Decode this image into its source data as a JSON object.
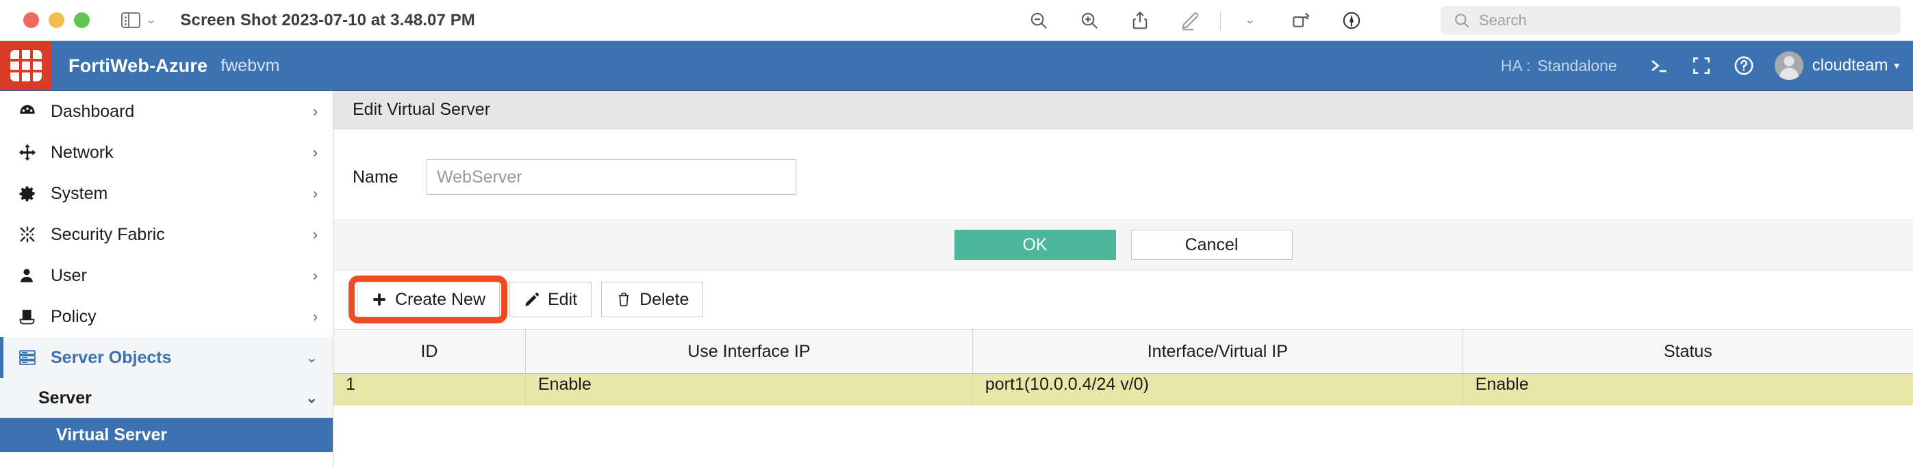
{
  "window": {
    "title": "Screen Shot 2023-07-10 at 3.48.07 PM",
    "traffic_lights": [
      "close",
      "minimize",
      "zoom"
    ],
    "sidebar_toggle_icon": "sidebar-panel-icon",
    "toolbar": [
      {
        "name": "zoom-out",
        "icon": "magnifier-minus-icon"
      },
      {
        "name": "zoom-in",
        "icon": "magnifier-plus-icon"
      },
      {
        "name": "share",
        "icon": "share-upload-icon"
      },
      {
        "name": "markup",
        "icon": "pencil-markup-icon"
      },
      {
        "name": "markup-dropdown",
        "icon": "chevron-down-icon"
      },
      {
        "name": "rotate",
        "icon": "rotate-left-icon"
      },
      {
        "name": "annotate",
        "icon": "annotate-circle-icon"
      }
    ],
    "search": {
      "placeholder": "Search",
      "value": "",
      "icon": "search-icon"
    }
  },
  "appbar": {
    "logo": "fortinet-logo",
    "brand": "FortiWeb-Azure",
    "hostname": "fwebvm",
    "ha_label": "HA :",
    "ha_value": "Standalone",
    "cli_icon": "cli-console-icon",
    "fullscreen_icon": "fullscreen-icon",
    "help_icon": "help-question-icon",
    "avatar": "user-avatar",
    "user": "cloudteam",
    "user_caret": "▾",
    "accent_blue": "#3c72b2",
    "logo_red": "#da3b26"
  },
  "sidebar": {
    "items": [
      {
        "label": "Dashboard",
        "icon": "dashboard-gauge-icon",
        "chevron": "›",
        "state": "collapsed"
      },
      {
        "label": "Network",
        "icon": "network-arrows-icon",
        "chevron": "›",
        "state": "collapsed"
      },
      {
        "label": "System",
        "icon": "gear-icon",
        "chevron": "›",
        "state": "collapsed"
      },
      {
        "label": "Security Fabric",
        "icon": "security-fabric-icon",
        "chevron": "›",
        "state": "collapsed"
      },
      {
        "label": "User",
        "icon": "user-icon",
        "chevron": "›",
        "state": "collapsed"
      },
      {
        "label": "Policy",
        "icon": "policy-document-icon",
        "chevron": "›",
        "state": "collapsed"
      },
      {
        "label": "Server Objects",
        "icon": "server-rack-icon",
        "chevron": "⌄",
        "state": "expanded"
      }
    ],
    "subgroup": {
      "label": "Server",
      "chevron": "⌄"
    },
    "selected_leaf": {
      "label": "Virtual Server"
    }
  },
  "panel": {
    "title": "Edit Virtual Server",
    "form": {
      "name_label": "Name",
      "name_placeholder": "WebServer",
      "name_value": ""
    },
    "buttons": {
      "ok": "OK",
      "cancel": "Cancel",
      "ok_color": "#4cb79a"
    }
  },
  "actions": {
    "create_new": {
      "label": "Create New",
      "icon": "plus-icon"
    },
    "edit": {
      "label": "Edit",
      "icon": "pencil-icon"
    },
    "delete": {
      "label": "Delete",
      "icon": "trash-icon"
    },
    "highlight_color": "#f04a23"
  },
  "table": {
    "columns": [
      "ID",
      "Use Interface IP",
      "Interface/Virtual IP",
      "Status"
    ],
    "rows": [
      [
        "1",
        "Enable",
        "port1(10.0.0.4/24 v/0)",
        "Enable"
      ]
    ],
    "row_highlight_color": "#e8e6a8"
  }
}
